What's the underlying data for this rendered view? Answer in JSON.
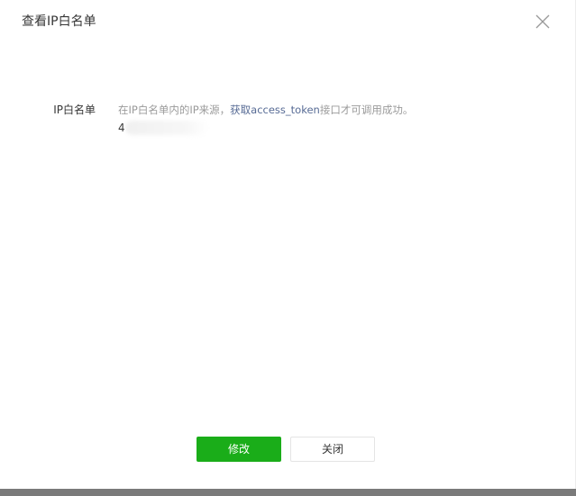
{
  "dialog": {
    "title": "查看IP白名单",
    "close_icon": "close-icon"
  },
  "form": {
    "label": "IP白名单",
    "hint_prefix": "在IP白名单内的IP来源，",
    "hint_link": "获取access_token",
    "hint_suffix": "接口才可调用成功。",
    "ip_value": "4"
  },
  "footer": {
    "primary_label": "修改",
    "secondary_label": "关闭"
  },
  "colors": {
    "primary": "#1aad19",
    "link": "#576b95",
    "hint": "#9a9a9a",
    "text": "#353535"
  }
}
